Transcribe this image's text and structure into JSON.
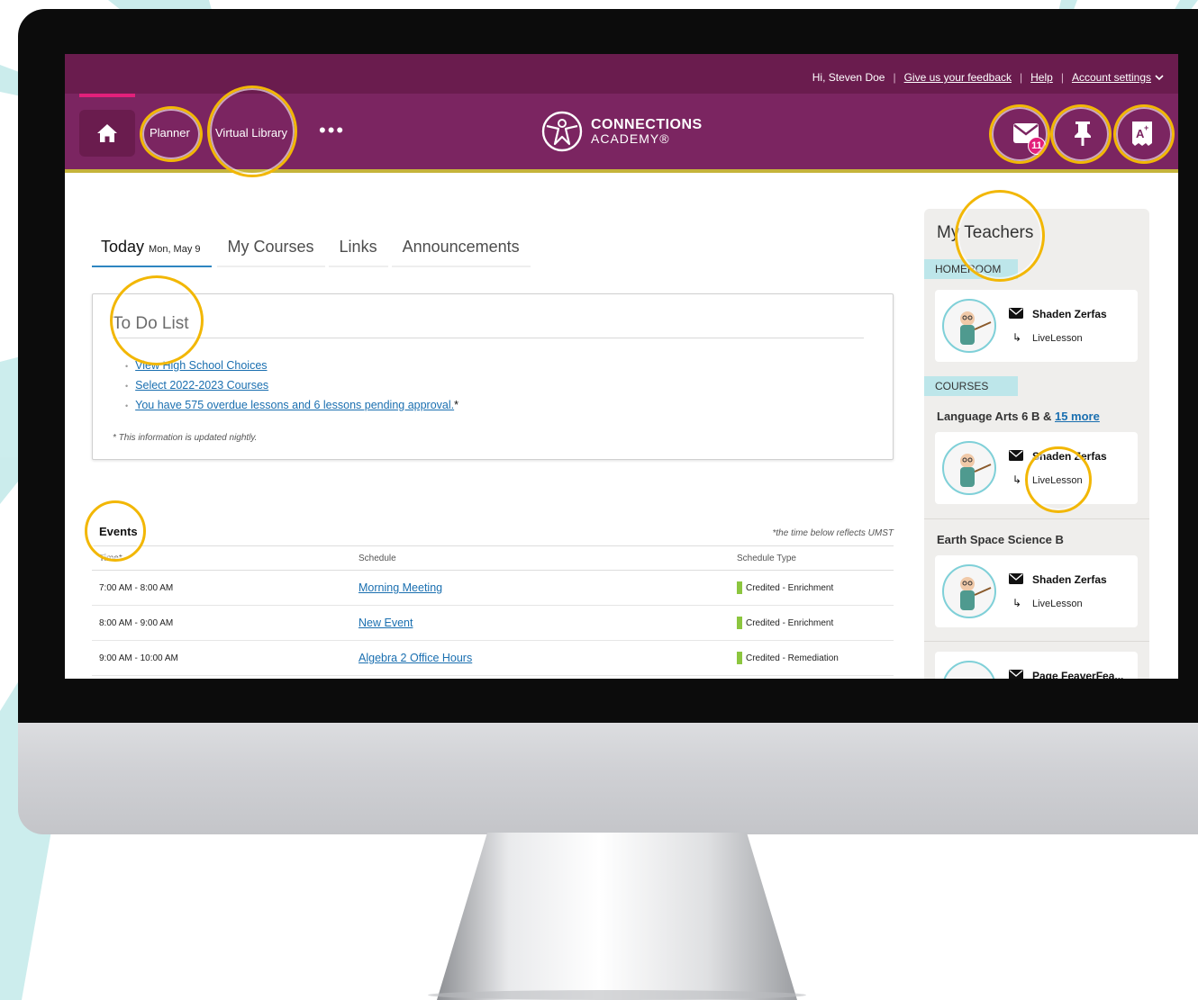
{
  "header": {
    "greeting": "Hi, Steven Doe",
    "feedback_link": "Give us your feedback",
    "help_link": "Help",
    "account_link": "Account settings",
    "account_chevron_icon": "chevron-down-icon"
  },
  "nav": {
    "home_icon": "home-icon",
    "planner_label": "Planner",
    "virtual_library_label": "Virtual Library",
    "more_label": "•••",
    "logo_line1": "CONNECTIONS",
    "logo_line2": "ACADEMY®",
    "mail_icon": "mail-icon",
    "mail_badge": "11",
    "pin_icon": "pin-icon",
    "grades_icon": "grades-icon"
  },
  "tabs": {
    "today_label": "Today",
    "today_date": "Mon, May 9",
    "courses_label": "My Courses",
    "links_label": "Links",
    "announcements_label": "Announcements"
  },
  "todo": {
    "title": "To Do List",
    "items": [
      "View High School Choices",
      "Select 2022-2023 Courses",
      "You have 575 overdue lessons and 6 lessons pending approval."
    ],
    "asterisk": "*",
    "note": "* This information is updated nightly."
  },
  "events": {
    "title": "Events",
    "note": "*the time below reflects UMST",
    "columns": [
      "Time*",
      "Schedule",
      "Schedule Type"
    ],
    "rows": [
      {
        "time": "7:00 AM - 8:00 AM",
        "name": "Morning Meeting",
        "type": "Credited - Enrichment"
      },
      {
        "time": "8:00 AM - 9:00 AM",
        "name": "New Event",
        "type": "Credited - Enrichment"
      },
      {
        "time": "9:00 AM - 10:00 AM",
        "name": "Algebra 2 Office Hours",
        "type": "Credited - Remediation"
      }
    ],
    "type_color": "#8cc63f"
  },
  "teachers": {
    "title": "My Teachers",
    "homeroom_label": "HOMEROOM",
    "courses_label": "COURSES",
    "course1": "Language Arts 6 B & ",
    "course1_more": "15 more",
    "course2": "Earth Space Science B",
    "cards": [
      {
        "name": "Shaden Zerfas",
        "live": "LiveLesson"
      },
      {
        "name": "Shaden Zerfas",
        "live": "LiveLesson"
      },
      {
        "name": "Shaden Zerfas",
        "live": "LiveLesson"
      },
      {
        "name": "Page FeaverFea..."
      }
    ]
  },
  "colors": {
    "topbar": "#6a1c4e",
    "navbar": "#7b2561",
    "accent_pink": "#e2207b",
    "nav_underline": "#c5b43b",
    "link_blue": "#1a6fb0",
    "highlight_ring": "#f2b705",
    "callout_beam": "#c9ecec"
  }
}
